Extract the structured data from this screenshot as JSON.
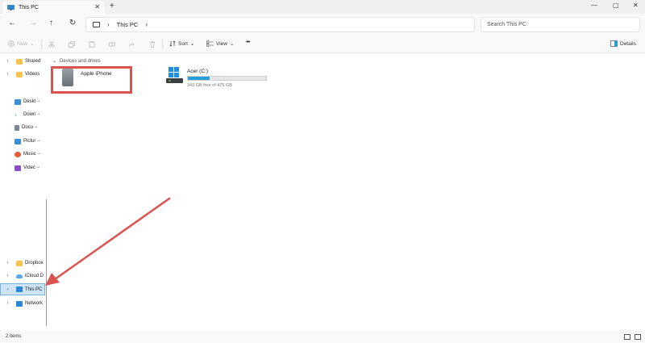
{
  "window": {
    "tab_title": "This PC",
    "close_tab": "✕",
    "new_tab": "+",
    "minimize": "—",
    "maximize": "▢",
    "close": "✕"
  },
  "nav": {
    "back": "←",
    "forward": "→",
    "up": "↑",
    "refresh": "↻",
    "breadcrumb_sep": "›",
    "breadcrumb": "This PC",
    "search_placeholder": "Search This PC"
  },
  "commands": {
    "new": "New",
    "sort": "Sort",
    "view": "View",
    "more": "•••",
    "details": "Details"
  },
  "sidebar": {
    "top": [
      {
        "label": "Shared",
        "chev": "›"
      },
      {
        "label": "Videos",
        "chev": "›"
      }
    ],
    "quick": [
      {
        "label": "Deskt",
        "pin": "📌"
      },
      {
        "label": "Down",
        "pin": "📌"
      },
      {
        "label": "Docu",
        "pin": "📌"
      },
      {
        "label": "Pictur",
        "pin": "📌"
      },
      {
        "label": "Music",
        "pin": "📌"
      },
      {
        "label": "Videc",
        "pin": "📌"
      }
    ],
    "bottom": [
      {
        "label": "Dropbox",
        "chev": "›"
      },
      {
        "label": "iCloud D",
        "chev": "›"
      },
      {
        "label": "This PC",
        "chev": "›"
      },
      {
        "label": "Network",
        "chev": "›"
      }
    ]
  },
  "content": {
    "section_title": "Devices and drives",
    "section_chev": "⌄",
    "devices": [
      {
        "name": "Apple iPhone"
      },
      {
        "name": "Acer (C:)",
        "free_text": "343 GB free of 475 GB",
        "used_fraction": 0.28
      }
    ]
  },
  "status": {
    "item_count": "2 items"
  },
  "colors": {
    "accent": "#26a0da",
    "highlight": "#d9534f",
    "selection": "#cde4f7"
  }
}
